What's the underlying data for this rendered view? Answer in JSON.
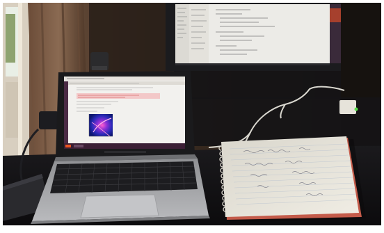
{
  "photo": {
    "palette": {
      "wall": "#2f241c",
      "curtain": "#5a4131",
      "window_frame": "#d8cfc0",
      "window_glass": "#e9efe6",
      "greenery": "#6f8a48",
      "desk": "#121113",
      "laptop_body": "#a9aaac",
      "laptop_keys": "#1d1d20",
      "laptop_screen_bg": "#f2f1ee",
      "ubuntu_bar": "#3b1f35",
      "monitor_bezel": "#1b1b1e",
      "monitor_screen": "#ecebe7",
      "notebook_paper": "#e9e6dd",
      "notebook_edge": "#c45b4a",
      "cable": "#d9d7cf",
      "led": "#5adf4a"
    }
  }
}
